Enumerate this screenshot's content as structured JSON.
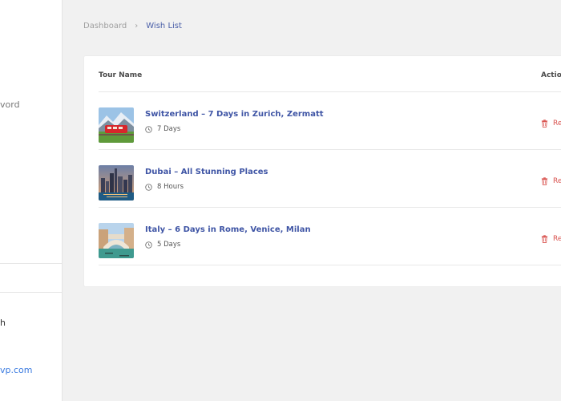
{
  "sidebar": {
    "nav_partial": "vord",
    "info_partial": "h",
    "email_partial": "vp.com"
  },
  "breadcrumb": {
    "home": "Dashboard",
    "separator": "›",
    "current": "Wish List"
  },
  "table": {
    "columns": {
      "tour_name": "Tour Name",
      "action": "Action"
    },
    "rows": [
      {
        "title": "Switzerland – 7 Days in Zurich, Zermatt",
        "duration": "7 Days",
        "thumbnail": "red-train-mountain-image",
        "remove_label": "Remove"
      },
      {
        "title": "Dubai – All Stunning Places",
        "duration": "8 Hours",
        "thumbnail": "dubai-skyline-image",
        "remove_label": "Remove"
      },
      {
        "title": "Italy – 6 Days in Rome, Venice, Milan",
        "duration": "5 Days",
        "thumbnail": "venice-bridge-image",
        "remove_label": "Remove"
      }
    ]
  },
  "colors": {
    "accent": "#3f55a5",
    "remove": "#d9534f",
    "background": "#f1f1f1"
  }
}
